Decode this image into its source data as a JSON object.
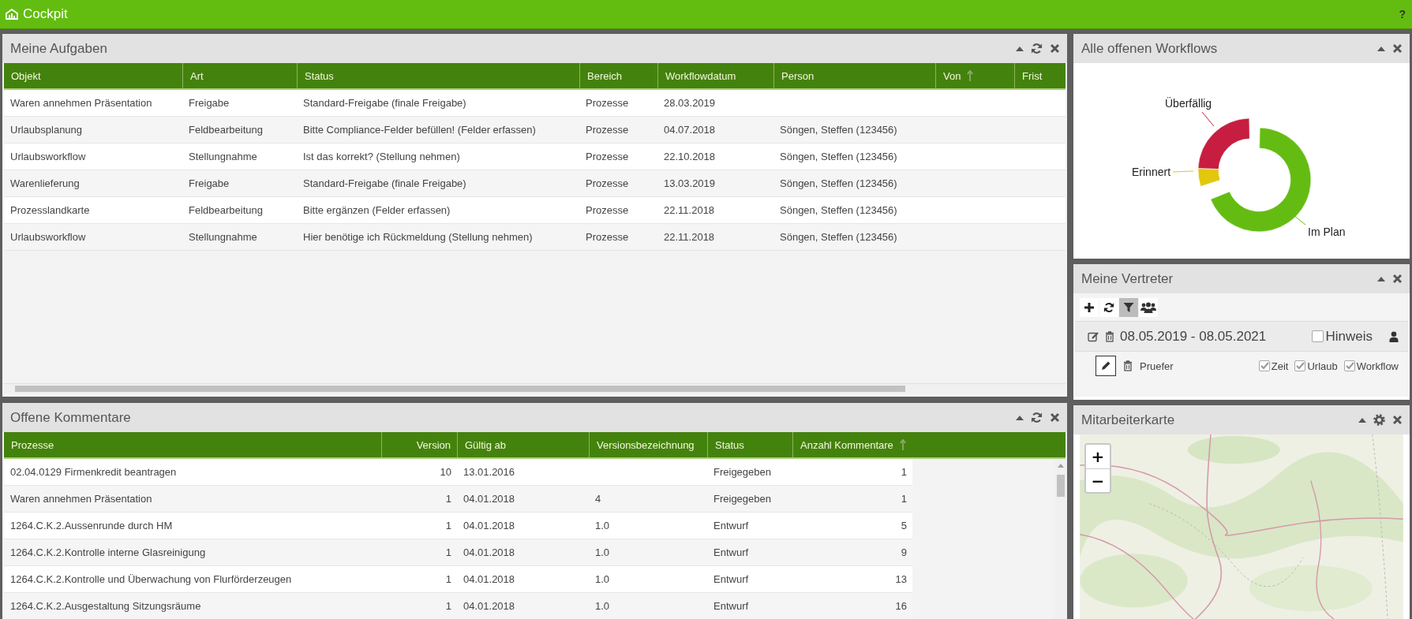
{
  "app_bar": {
    "title": "Cockpit",
    "help": "?"
  },
  "tasks_panel": {
    "title": "Meine Aufgaben",
    "columns": [
      {
        "label": "Objekt",
        "sorted": false
      },
      {
        "label": "Art",
        "sorted": false
      },
      {
        "label": "Status",
        "sorted": false
      },
      {
        "label": "Bereich",
        "sorted": false
      },
      {
        "label": "Workflowdatum",
        "sorted": false
      },
      {
        "label": "Person",
        "sorted": false
      },
      {
        "label": "Von",
        "sorted": true
      },
      {
        "label": "Frist",
        "sorted": false
      }
    ],
    "rows": [
      {
        "objekt": "Waren annehmen Präsentation",
        "art": "Freigabe",
        "status": "Standard-Freigabe (finale Freigabe)",
        "bereich": "Prozesse",
        "workflowdatum": "28.03.2019"
      },
      {
        "objekt": "Urlaubsplanung",
        "art": "Feldbearbeitung",
        "status": "Bitte Compliance-Felder befüllen! (Felder erfassen)",
        "bereich": "Prozesse",
        "workflowdatum": "04.07.2018",
        "person": "Söngen, Steffen (123456)"
      },
      {
        "objekt": "Urlaubsworkflow",
        "art": "Stellungnahme",
        "status": "Ist das korrekt? (Stellung nehmen)",
        "bereich": "Prozesse",
        "workflowdatum": "22.10.2018",
        "person": "Söngen, Steffen (123456)"
      },
      {
        "objekt": "Warenlieferung",
        "art": "Freigabe",
        "status": "Standard-Freigabe (finale Freigabe)",
        "bereich": "Prozesse",
        "workflowdatum": "13.03.2019",
        "person": "Söngen, Steffen (123456)"
      },
      {
        "objekt": "Prozesslandkarte",
        "art": "Feldbearbeitung",
        "status": "Bitte ergänzen (Felder erfassen)",
        "bereich": "Prozesse",
        "workflowdatum": "22.11.2018",
        "person": "Söngen, Steffen (123456)"
      },
      {
        "objekt": "Urlaubsworkflow",
        "art": "Stellungnahme",
        "status": "Hier benötige ich Rückmeldung (Stellung nehmen)",
        "bereich": "Prozesse",
        "workflowdatum": "22.11.2018",
        "person": "Söngen, Steffen (123456)"
      }
    ]
  },
  "workflows_panel": {
    "title": "Alle offenen Workflows",
    "slices": [
      {
        "label": "Überfällig",
        "color": "#c71d40"
      },
      {
        "label": "Erinnert",
        "color": "#e2c80c"
      },
      {
        "label": "Im Plan",
        "color": "#64bc12"
      }
    ]
  },
  "deputies_panel": {
    "title": "Meine Vertreter",
    "toolbar": [
      {
        "kind": "add",
        "selected": false
      },
      {
        "kind": "refresh",
        "selected": false
      },
      {
        "kind": "filter",
        "selected": true
      },
      {
        "kind": "group",
        "selected": false
      }
    ],
    "period": "08.05.2019 - 08.05.2021",
    "hint": {
      "label": "Hinweis",
      "checked": false
    },
    "role": "Pruefer",
    "options": [
      {
        "label": "Zeit",
        "checked": true
      },
      {
        "label": "Urlaub",
        "checked": true
      },
      {
        "label": "Workflow",
        "checked": true
      }
    ]
  },
  "comments_panel": {
    "title": "Offene Kommentare",
    "columns": [
      {
        "label": "Prozesse",
        "sorted": false
      },
      {
        "label": "Version",
        "sorted": false
      },
      {
        "label": "Gültig ab",
        "sorted": false
      },
      {
        "label": "Versionsbezeichnung",
        "sorted": false
      },
      {
        "label": "Status",
        "sorted": false
      },
      {
        "label": "Anzahl Kommentare",
        "sorted": true
      }
    ],
    "rows": [
      {
        "prozesse": "02.04.0129 Firmenkredit beantragen",
        "version": "10",
        "gueltig_ab": "13.01.2016",
        "status": "Freigegeben",
        "anzahl_kommentare": "1"
      },
      {
        "prozesse": "Waren annehmen Präsentation",
        "version": "1",
        "gueltig_ab": "04.01.2018",
        "versionsbezeichnung": "4",
        "status": "Freigegeben",
        "anzahl_kommentare": "1"
      },
      {
        "prozesse": "1264.C.K.2.Aussenrunde durch HM",
        "version": "1",
        "gueltig_ab": "04.01.2018",
        "versionsbezeichnung": "1.0",
        "status": "Entwurf",
        "anzahl_kommentare": "5"
      },
      {
        "prozesse": "1264.C.K.2.Kontrolle interne Glasreinigung",
        "version": "1",
        "gueltig_ab": "04.01.2018",
        "versionsbezeichnung": "1.0",
        "status": "Entwurf",
        "anzahl_kommentare": "9"
      },
      {
        "prozesse": "1264.C.K.2.Kontrolle und Überwachung von Flurförderzeugen",
        "version": "1",
        "gueltig_ab": "04.01.2018",
        "versionsbezeichnung": "1.0",
        "status": "Entwurf",
        "anzahl_kommentare": "13"
      },
      {
        "prozesse": "1264.C.K.2.Ausgestaltung Sitzungsräume",
        "version": "1",
        "gueltig_ab": "04.01.2018",
        "versionsbezeichnung": "1.0",
        "status": "Entwurf",
        "anzahl_kommentare": "16"
      }
    ]
  },
  "map_panel": {
    "title": "Mitarbeiterkarte",
    "zoom_in": "+",
    "zoom_out": "−"
  }
}
